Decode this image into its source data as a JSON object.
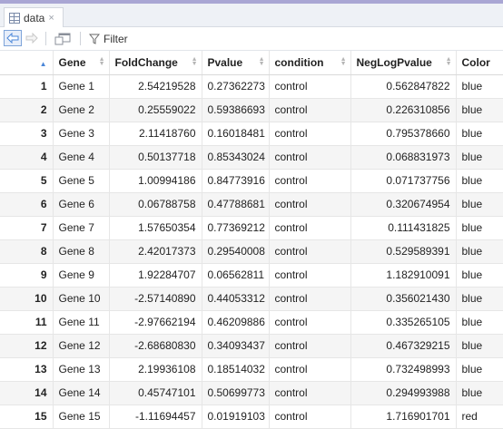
{
  "tab": {
    "name": "data",
    "close": "×"
  },
  "toolbar": {
    "filter_label": "Filter"
  },
  "columns": [
    "Gene",
    "FoldChange",
    "Pvalue",
    "condition",
    "NegLogPvalue",
    "Color"
  ],
  "rows": [
    [
      "1",
      "Gene 1",
      "2.54219528",
      "0.27362273",
      "control",
      "0.562847822",
      "blue"
    ],
    [
      "2",
      "Gene 2",
      "0.25559022",
      "0.59386693",
      "control",
      "0.226310856",
      "blue"
    ],
    [
      "3",
      "Gene 3",
      "2.11418760",
      "0.16018481",
      "control",
      "0.795378660",
      "blue"
    ],
    [
      "4",
      "Gene 4",
      "0.50137718",
      "0.85343024",
      "control",
      "0.068831973",
      "blue"
    ],
    [
      "5",
      "Gene 5",
      "1.00994186",
      "0.84773916",
      "control",
      "0.071737756",
      "blue"
    ],
    [
      "6",
      "Gene 6",
      "0.06788758",
      "0.47788681",
      "control",
      "0.320674954",
      "blue"
    ],
    [
      "7",
      "Gene 7",
      "1.57650354",
      "0.77369212",
      "control",
      "0.111431825",
      "blue"
    ],
    [
      "8",
      "Gene 8",
      "2.42017373",
      "0.29540008",
      "control",
      "0.529589391",
      "blue"
    ],
    [
      "9",
      "Gene 9",
      "1.92284707",
      "0.06562811",
      "control",
      "1.182910091",
      "blue"
    ],
    [
      "10",
      "Gene 10",
      "-2.57140890",
      "0.44053312",
      "control",
      "0.356021430",
      "blue"
    ],
    [
      "11",
      "Gene 11",
      "-2.97662194",
      "0.46209886",
      "control",
      "0.335265105",
      "blue"
    ],
    [
      "12",
      "Gene 12",
      "-2.68680830",
      "0.34093437",
      "control",
      "0.467329215",
      "blue"
    ],
    [
      "13",
      "Gene 13",
      "2.19936108",
      "0.18514032",
      "control",
      "0.732498993",
      "blue"
    ],
    [
      "14",
      "Gene 14",
      "0.45747101",
      "0.50699773",
      "control",
      "0.294993988",
      "blue"
    ],
    [
      "15",
      "Gene 15",
      "-1.11694457",
      "0.01919103",
      "control",
      "1.716901701",
      "red"
    ]
  ],
  "colors": {
    "accent": "#4a86d8",
    "stripe": "#a9a6d4",
    "row_alt": "#f5f5f5"
  }
}
